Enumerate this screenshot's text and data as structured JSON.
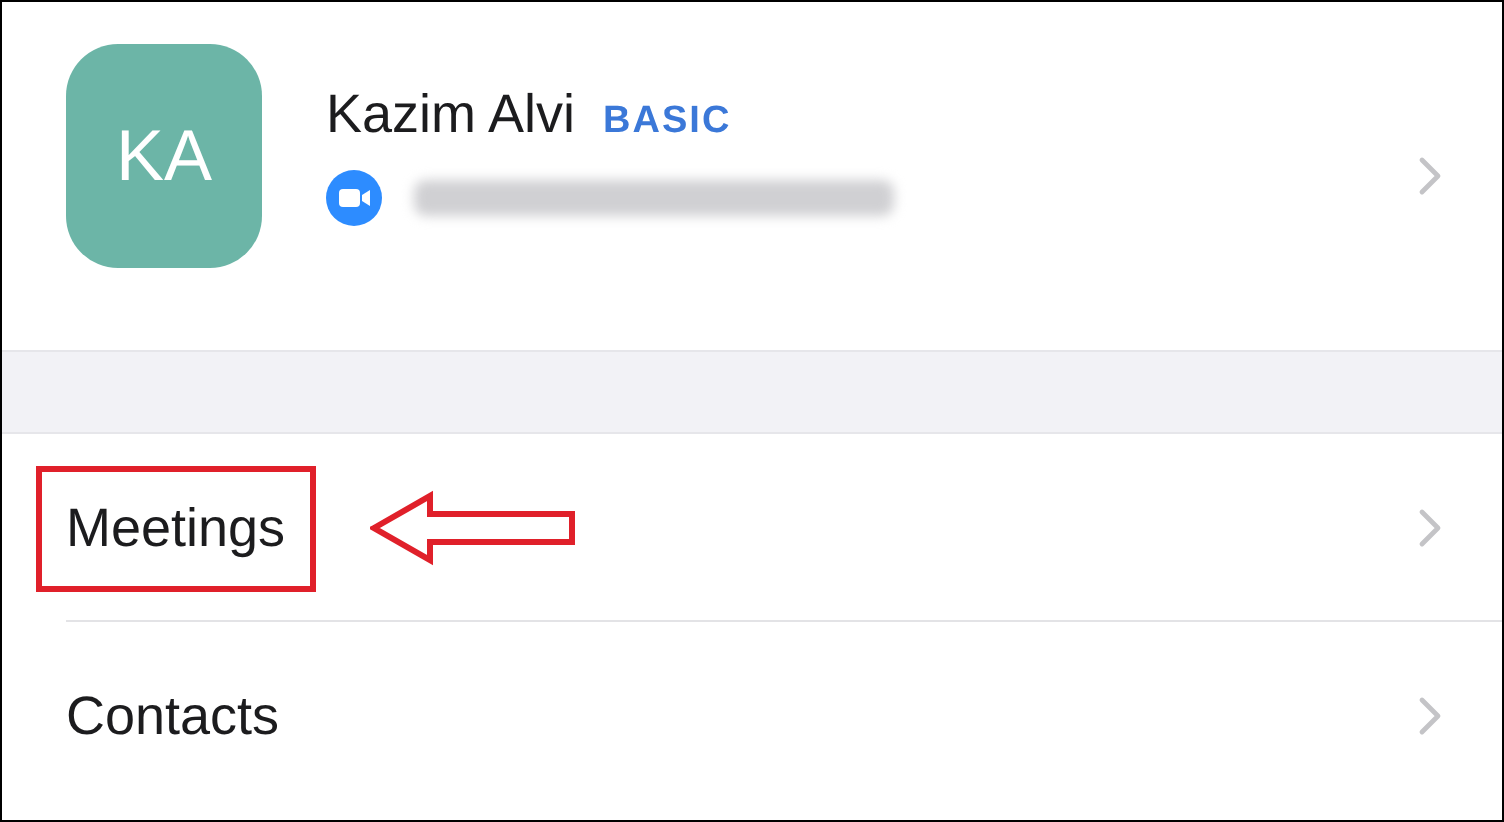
{
  "profile": {
    "initials": "KA",
    "name": "Kazim Alvi",
    "plan": "BASIC"
  },
  "menu_items": [
    {
      "label": "Meetings",
      "annotated": true
    },
    {
      "label": "Contacts",
      "annotated": false
    }
  ]
}
